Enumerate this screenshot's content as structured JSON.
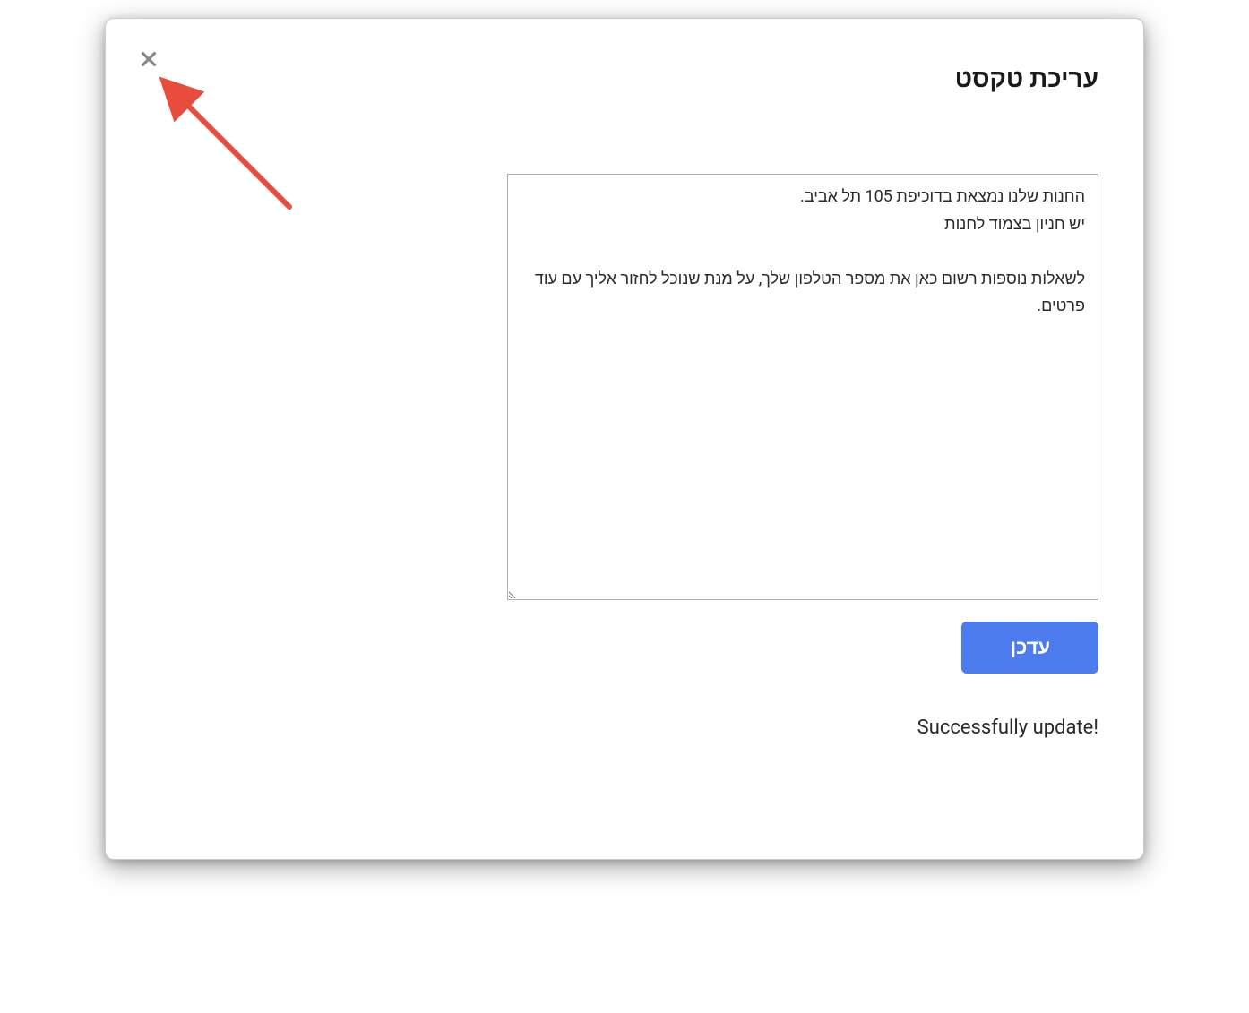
{
  "modal": {
    "title": "עריכת טקסט",
    "textarea_value": "החנות שלנו נמצאת בדוכיפת 105 תל אביב.\nיש חניון בצמוד לחנות\n\nלשאלות נוספות רשום כאן את מספר הטלפון שלך, על מנת שנוכל לחזור אליך עם עוד פרטים.",
    "update_button_label": "עדכן",
    "status_message": "Successfully update!"
  },
  "annotation": {
    "arrow_color": "#e74c3c"
  }
}
